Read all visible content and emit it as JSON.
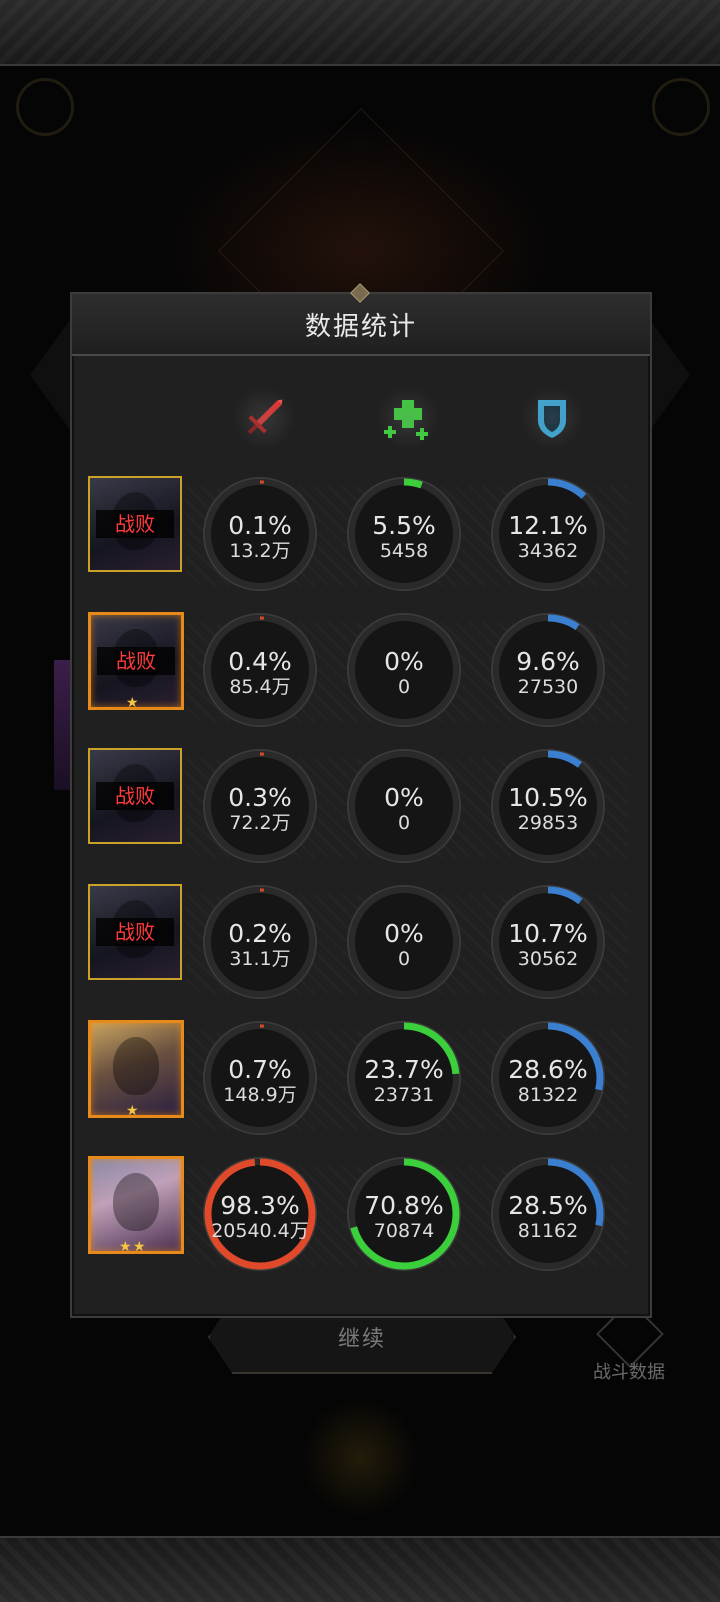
{
  "panel": {
    "title": "数据统计"
  },
  "columns": [
    {
      "icon": "sword-icon",
      "color": "#e23030"
    },
    {
      "icon": "heal-cross-icon",
      "color": "#3ccf3c"
    },
    {
      "icon": "shield-icon",
      "color": "#3aa8d8"
    }
  ],
  "rows": [
    {
      "status": "战败",
      "frame": "gold",
      "stars": 0,
      "damage": {
        "pct": "0.1%",
        "value": "13.2万",
        "ratio": 0.001
      },
      "heal": {
        "pct": "5.5%",
        "value": "5458",
        "ratio": 0.055
      },
      "tank": {
        "pct": "12.1%",
        "value": "34362",
        "ratio": 0.121
      }
    },
    {
      "status": "战败",
      "frame": "orange",
      "stars": 1,
      "damage": {
        "pct": "0.4%",
        "value": "85.4万",
        "ratio": 0.004
      },
      "heal": {
        "pct": "0%",
        "value": "0",
        "ratio": 0
      },
      "tank": {
        "pct": "9.6%",
        "value": "27530",
        "ratio": 0.096
      }
    },
    {
      "status": "战败",
      "frame": "gold",
      "stars": 0,
      "damage": {
        "pct": "0.3%",
        "value": "72.2万",
        "ratio": 0.003
      },
      "heal": {
        "pct": "0%",
        "value": "0",
        "ratio": 0
      },
      "tank": {
        "pct": "10.5%",
        "value": "29853",
        "ratio": 0.105
      }
    },
    {
      "status": "战败",
      "frame": "gold",
      "stars": 0,
      "damage": {
        "pct": "0.2%",
        "value": "31.1万",
        "ratio": 0.002
      },
      "heal": {
        "pct": "0%",
        "value": "0",
        "ratio": 0
      },
      "tank": {
        "pct": "10.7%",
        "value": "30562",
        "ratio": 0.107
      }
    },
    {
      "status": "",
      "frame": "orange",
      "stars": 1,
      "damage": {
        "pct": "0.7%",
        "value": "148.9万",
        "ratio": 0.007
      },
      "heal": {
        "pct": "23.7%",
        "value": "23731",
        "ratio": 0.237
      },
      "tank": {
        "pct": "28.6%",
        "value": "81322",
        "ratio": 0.286
      }
    },
    {
      "status": "",
      "frame": "orange",
      "stars": 2,
      "damage": {
        "pct": "98.3%",
        "value": "20540.4万",
        "ratio": 0.983
      },
      "heal": {
        "pct": "70.8%",
        "value": "70874",
        "ratio": 0.708
      },
      "tank": {
        "pct": "28.5%",
        "value": "81162",
        "ratio": 0.285
      }
    }
  ],
  "colors": {
    "damage": "#e04a2a",
    "heal": "#3ccf3c",
    "tank": "#3a7fd0",
    "ring_bg": "#151515",
    "ring_border": "#3a3a3a"
  },
  "continue_button": {
    "label": "继续"
  },
  "battle_data": {
    "label": "战斗数据"
  }
}
